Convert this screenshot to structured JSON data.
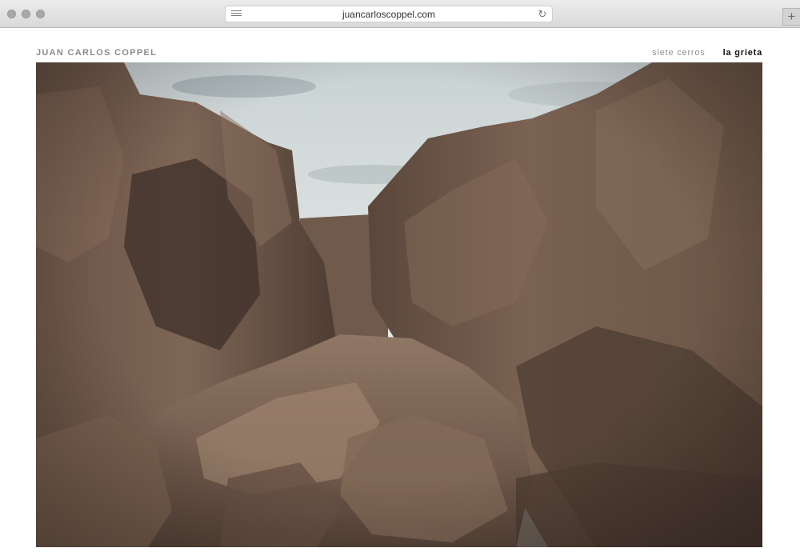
{
  "browser": {
    "url": "juancarloscoppel.com",
    "reader_icon": "reader-lines-icon",
    "reload_icon": "reload-icon",
    "new_tab_label": "+"
  },
  "site": {
    "logo": "JUAN CARLOS COPPEL",
    "nav": [
      {
        "label": "siete cerros",
        "active": false
      },
      {
        "label": "la grieta",
        "active": true
      }
    ]
  },
  "colors": {
    "logo": "#8c8c8c",
    "nav_inactive": "#8f8f8f",
    "nav_active": "#111111"
  }
}
